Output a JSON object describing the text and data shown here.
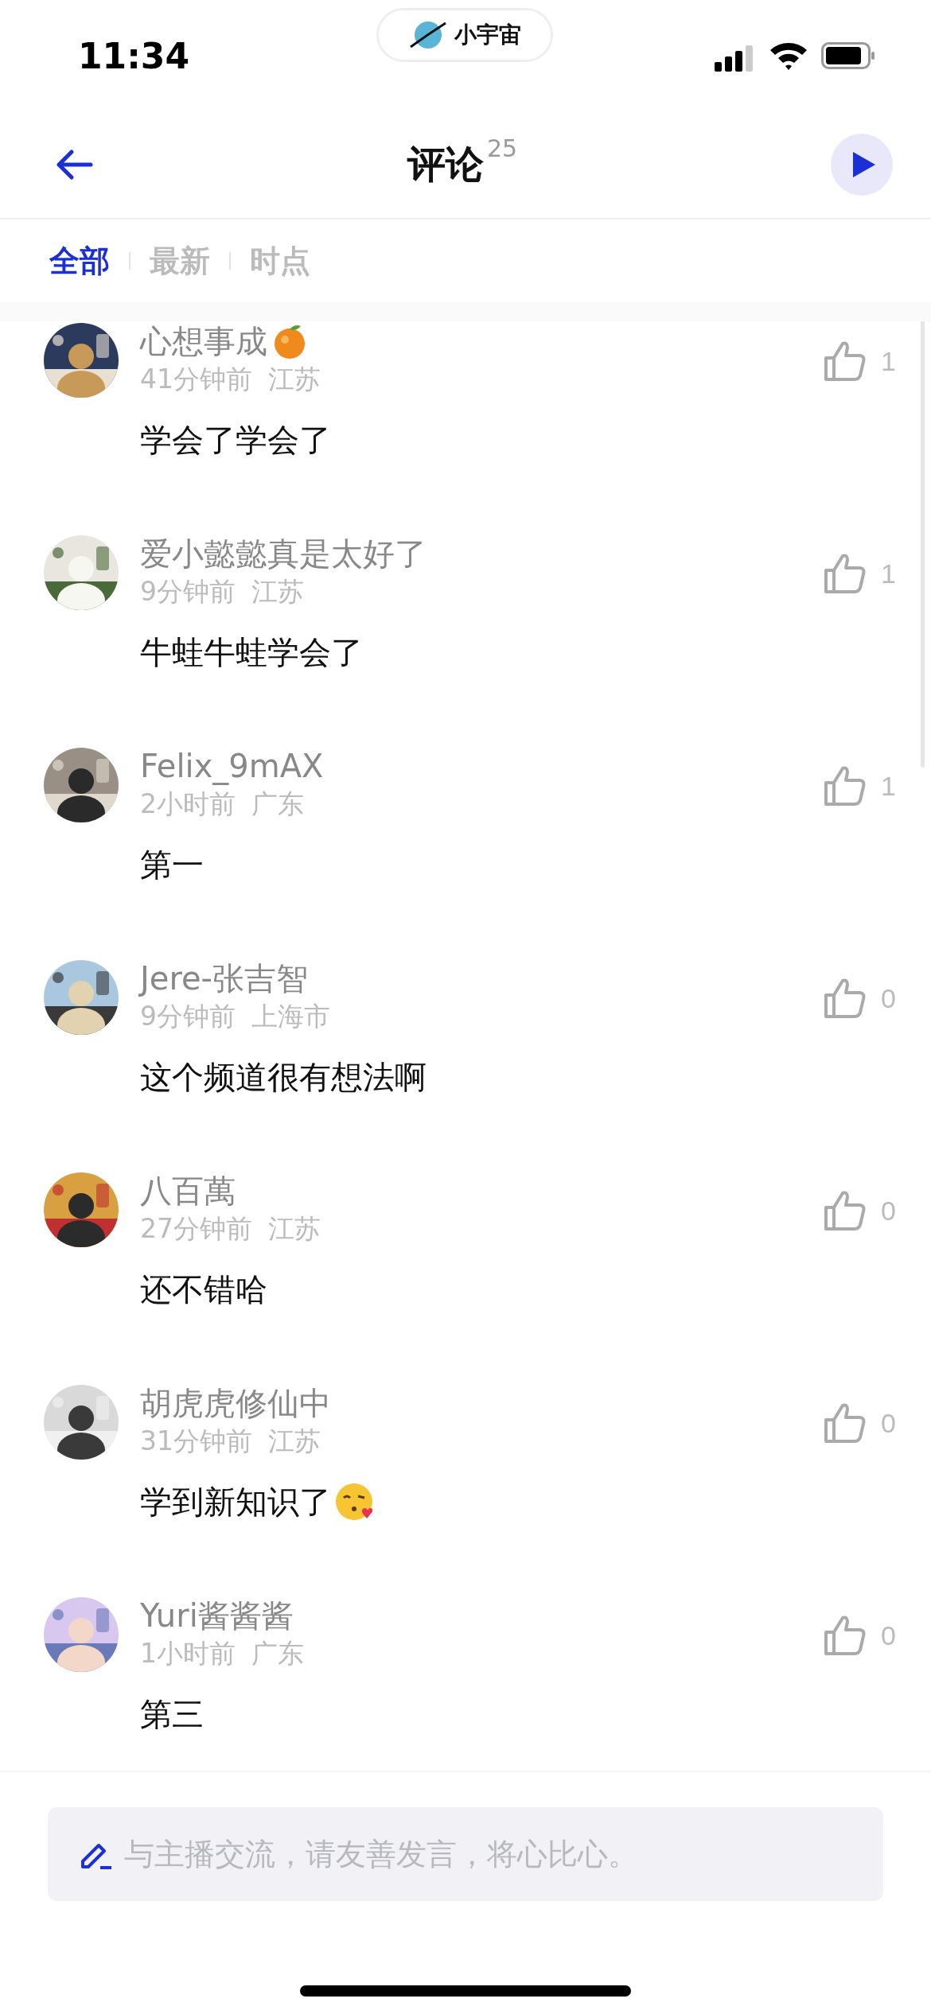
{
  "status_bar": {
    "time": "11:34",
    "island_label": "小宇宙"
  },
  "header": {
    "title": "评论",
    "count": "25"
  },
  "tabs": [
    {
      "label": "全部",
      "selected": true
    },
    {
      "label": "最新",
      "selected": false
    },
    {
      "label": "时点",
      "selected": false
    }
  ],
  "comments": [
    {
      "name": "心想事成",
      "name_emoji": true,
      "time": "41分钟前",
      "location": "江苏",
      "text": "学会了学会了",
      "likes": "1"
    },
    {
      "name": "爱小懿懿真是太好了",
      "time": "9分钟前",
      "location": "江苏",
      "text": "牛蛙牛蛙学会了",
      "likes": "1"
    },
    {
      "name": "Felix_9mAX",
      "time": "2小时前",
      "location": "广东",
      "text": "第一",
      "likes": "1"
    },
    {
      "name": "Jere-张吉智",
      "time": "9分钟前",
      "location": "上海市",
      "text": "这个频道很有想法啊",
      "likes": "0"
    },
    {
      "name": "八百萬",
      "time": "27分钟前",
      "location": "江苏",
      "text": "还不错哈",
      "likes": "0"
    },
    {
      "name": "胡虎虎修仙中",
      "time": "31分钟前",
      "location": "江苏",
      "text": "学到新知识了",
      "text_emoji": true,
      "likes": "0"
    },
    {
      "name": "Yuri酱酱酱",
      "time": "1小时前",
      "location": "广东",
      "text": "第三",
      "likes": "0"
    }
  ],
  "input": {
    "placeholder": "与主播交流，请友善发言，将心比心。"
  }
}
